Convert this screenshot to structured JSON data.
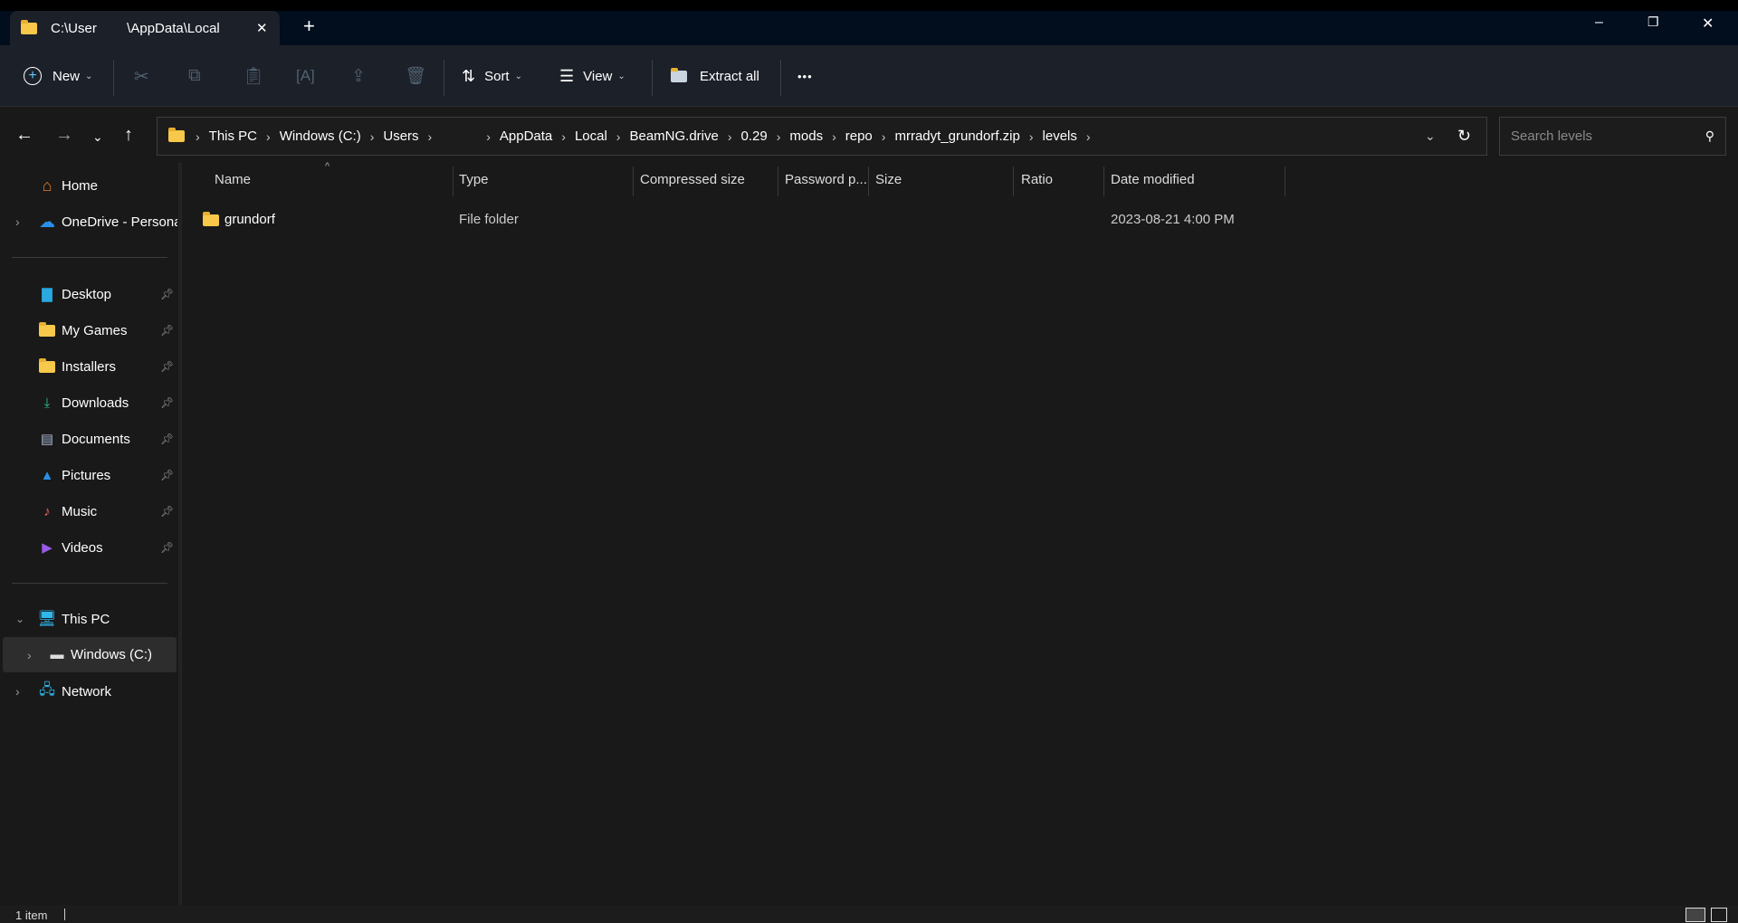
{
  "window": {
    "tab_title": "C:\\User        \\AppData\\Local",
    "new_tab": "+",
    "minimize": "–",
    "restore": "❐",
    "close": "✕"
  },
  "toolbar": {
    "new_label": "New",
    "sort_label": "Sort",
    "view_label": "View",
    "extract_label": "Extract all",
    "more_label": "•••"
  },
  "address": {
    "crumbs": [
      "This PC",
      "Windows (C:)",
      "Users",
      "",
      "AppData",
      "Local",
      "BeamNG.drive",
      "0.29",
      "mods",
      "repo",
      "mrradyt_grundorf.zip",
      "levels"
    ],
    "search_placeholder": "Search levels"
  },
  "sidebar": {
    "home": "Home",
    "onedrive": "OneDrive - Persona",
    "pinned": [
      {
        "label": "Desktop",
        "icon": "desktop-icon"
      },
      {
        "label": "My Games",
        "icon": "folder-icon"
      },
      {
        "label": "Installers",
        "icon": "folder-icon"
      },
      {
        "label": "Downloads",
        "icon": "download-icon"
      },
      {
        "label": "Documents",
        "icon": "documents-icon"
      },
      {
        "label": "Pictures",
        "icon": "pictures-icon"
      },
      {
        "label": "Music",
        "icon": "music-icon"
      },
      {
        "label": "Videos",
        "icon": "videos-icon"
      }
    ],
    "this_pc": "This PC",
    "drive": "Windows (C:)",
    "network": "Network"
  },
  "columns": [
    "Name",
    "Type",
    "Compressed size",
    "Password p...",
    "Size",
    "Ratio",
    "Date modified"
  ],
  "rows": [
    {
      "name": "grundorf",
      "type": "File folder",
      "date": "2023-08-21 4:00 PM"
    }
  ],
  "status": {
    "count": "1 item"
  }
}
